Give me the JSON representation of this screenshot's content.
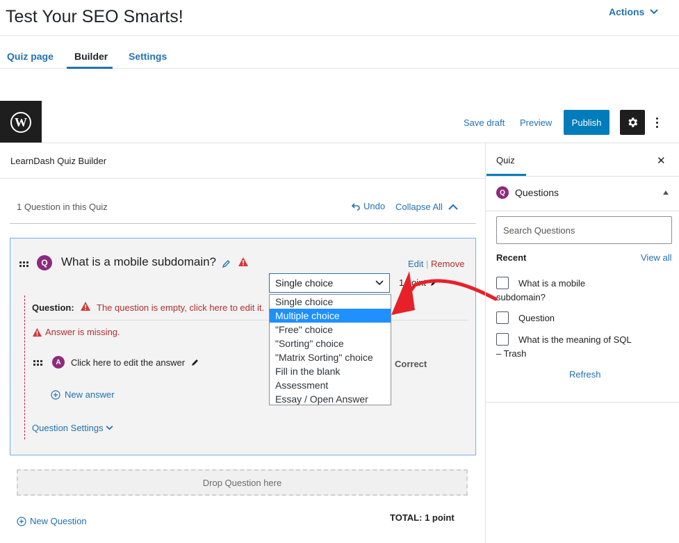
{
  "page": {
    "title": "Test Your SEO Smarts!",
    "actions_label": "Actions"
  },
  "tabs": [
    {
      "label": "Quiz page"
    },
    {
      "label": "Builder",
      "active": true
    },
    {
      "label": "Settings"
    }
  ],
  "toolbar": {
    "save_draft": "Save draft",
    "preview": "Preview",
    "publish": "Publish"
  },
  "builder": {
    "title": "LearnDash Quiz Builder",
    "question_count": "1 Question in this Quiz",
    "undo": "Undo",
    "collapse_all": "Collapse All",
    "question": {
      "badge": "Q",
      "title": "What is a mobile subdomain?",
      "edit": "Edit",
      "separator": "|",
      "remove": "Remove",
      "type_selected": "Single choice",
      "points": "1 point",
      "question_label": "Question:",
      "question_empty": "The question is empty, click here to edit it.",
      "answer_missing": "Answer is missing.",
      "answer_badge": "A",
      "answer_text": "Click here to edit the answer",
      "correct_label": "Correct",
      "new_answer": "New answer",
      "settings_label": "Question Settings"
    },
    "type_options": [
      {
        "label": "Single choice"
      },
      {
        "label": "Multiple choice",
        "highlighted": true
      },
      {
        "label": "\"Free\" choice"
      },
      {
        "label": "\"Sorting\" choice"
      },
      {
        "label": "\"Matrix Sorting\" choice"
      },
      {
        "label": "Fill in the blank"
      },
      {
        "label": "Assessment"
      },
      {
        "label": "Essay / Open Answer"
      }
    ],
    "drop_zone": "Drop Question here",
    "new_question": "New Question",
    "total": "TOTAL: 1 point"
  },
  "sidebar": {
    "tab": "Quiz",
    "questions_header": "Questions",
    "questions_badge": "Q",
    "search_placeholder": "Search Questions",
    "recent_label": "Recent",
    "view_all": "View all",
    "items": [
      {
        "line1": "What is a mobile",
        "line2": "subdomain?"
      },
      {
        "line1": "Question",
        "line2": ""
      },
      {
        "line1": "What is the meaning of SQL",
        "line2": "– Trash"
      }
    ],
    "refresh": "Refresh"
  },
  "colors": {
    "accent": "#2271b1",
    "publish": "#007cba",
    "error": "#b32d2e",
    "badge": "#8e2a7d",
    "highlight": "#1e90ff",
    "arrow": "#e8202a"
  },
  "icons": [
    "wordpress-icon",
    "gear-icon",
    "more-vertical-icon",
    "chevron-down-icon",
    "chevron-up-icon",
    "undo-icon",
    "pencil-icon",
    "warning-icon",
    "drag-handle-icon",
    "plus-circle-icon",
    "close-icon",
    "caret-up-icon"
  ]
}
